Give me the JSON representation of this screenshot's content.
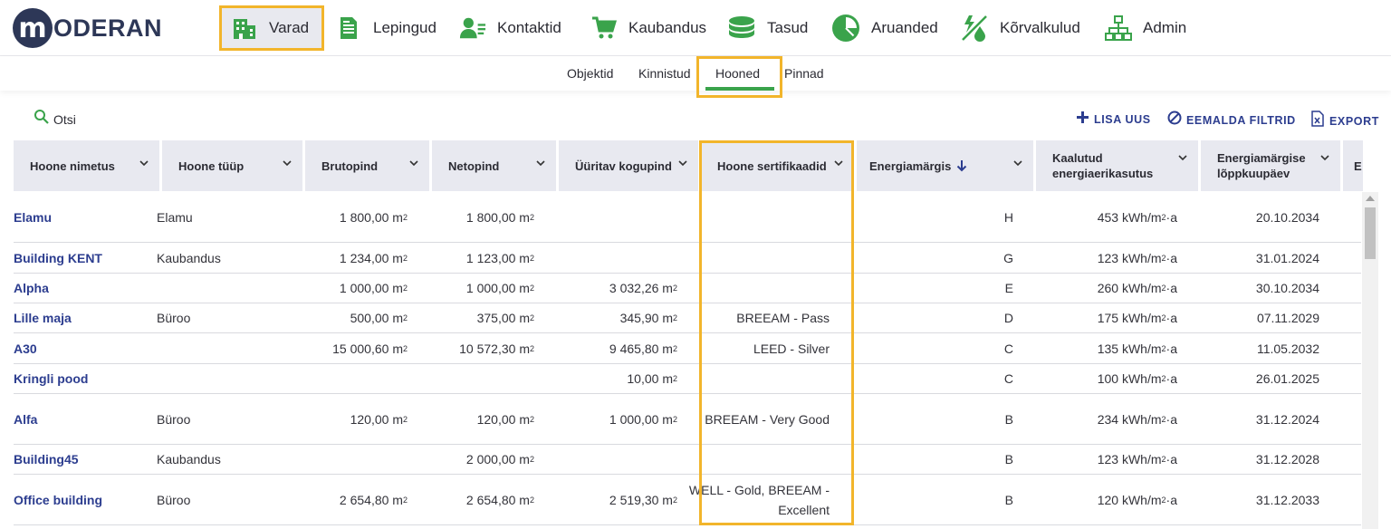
{
  "logo": {
    "letter": "m",
    "text": "ODERAN"
  },
  "nav": [
    {
      "label": "Varad",
      "icon": "buildings-icon",
      "active": true
    },
    {
      "label": "Lepingud",
      "icon": "document-icon"
    },
    {
      "label": "Kontaktid",
      "icon": "contacts-icon"
    },
    {
      "label": "Kaubandus",
      "icon": "cart-icon"
    },
    {
      "label": "Tasud",
      "icon": "coins-icon"
    },
    {
      "label": "Aruanded",
      "icon": "pie-chart-icon"
    },
    {
      "label": "Kõrvalkulud",
      "icon": "utilities-icon"
    },
    {
      "label": "Admin",
      "icon": "org-chart-icon"
    }
  ],
  "subnav": [
    {
      "label": "Objektid"
    },
    {
      "label": "Kinnistud"
    },
    {
      "label": "Hooned",
      "active": true
    },
    {
      "label": "Pinnad"
    }
  ],
  "toolbar": {
    "search_label": "Otsi",
    "add_label": "LISA UUS",
    "clear_filters_label": "EEMALDA FILTRID",
    "export_label": "EXPORT"
  },
  "columns": [
    {
      "label": "Hoone nimetus"
    },
    {
      "label": "Hoone tüüp"
    },
    {
      "label": "Brutopind"
    },
    {
      "label": "Netopind"
    },
    {
      "label": "Üüritav kogupind"
    },
    {
      "label": "Hoone sertifikaadid"
    },
    {
      "label": "Energiamärgis",
      "sorted": "desc"
    },
    {
      "label": "Kaalutud energiaerikasutus"
    },
    {
      "label": "Energiamärgise lõppkuupäev"
    },
    {
      "label": "E"
    }
  ],
  "rows": [
    {
      "name": "Elamu",
      "type": "Elamu",
      "gross": "1 800,00 m²",
      "net": "1 800,00 m²",
      "rentable": "",
      "cert": "",
      "label": "H",
      "energy": "453 kWh/m² ·a",
      "expiry": "20.10.2034"
    },
    {
      "name": "Building KENT",
      "type": "Kaubandus",
      "gross": "1 234,00 m²",
      "net": "1 123,00 m²",
      "rentable": "",
      "cert": "",
      "label": "G",
      "energy": "123 kWh/m² ·a",
      "expiry": "31.01.2024"
    },
    {
      "name": "Alpha",
      "type": "",
      "gross": "1 000,00 m²",
      "net": "1 000,00 m²",
      "rentable": "3 032,26 m²",
      "cert": "",
      "label": "E",
      "energy": "260 kWh/m² ·a",
      "expiry": "30.10.2034"
    },
    {
      "name": "Lille maja",
      "type": "Büroo",
      "gross": "500,00 m²",
      "net": "375,00 m²",
      "rentable": "345,90 m²",
      "cert": "BREEAM - Pass",
      "label": "D",
      "energy": "175 kWh/m² ·a",
      "expiry": "07.11.2029"
    },
    {
      "name": "A30",
      "type": "",
      "gross": "15 000,60 m²",
      "net": "10 572,30 m²",
      "rentable": "9 465,80 m²",
      "cert": "LEED - Silver",
      "label": "C",
      "energy": "135 kWh/m² ·a",
      "expiry": "11.05.2032"
    },
    {
      "name": "Kringli pood",
      "type": "",
      "gross": "",
      "net": "",
      "rentable": "10,00 m²",
      "cert": "",
      "label": "C",
      "energy": "100 kWh/m² ·a",
      "expiry": "26.01.2025"
    },
    {
      "name": "Alfa",
      "type": "Büroo",
      "gross": "120,00 m²",
      "net": "120,00 m²",
      "rentable": "1 000,00 m²",
      "cert": "BREEAM - Very Good",
      "label": "B",
      "energy": "234 kWh/m² ·a",
      "expiry": "31.12.2024"
    },
    {
      "name": "Building45",
      "type": "Kaubandus",
      "gross": "",
      "net": "2 000,00 m²",
      "rentable": "",
      "cert": "",
      "label": "B",
      "energy": "123 kWh/m² ·a",
      "expiry": "31.12.2028"
    },
    {
      "name": "Office building",
      "type": "Büroo",
      "gross": "2 654,80 m²",
      "net": "2 654,80 m²",
      "rentable": "2 519,30 m²",
      "cert": "WELL - Gold, BREEAM - Excellent",
      "label": "B",
      "energy": "120 kWh/m² ·a",
      "expiry": "31.12.2033"
    }
  ],
  "colors": {
    "accent_green": "#3aa34b",
    "link_blue": "#2c3d8f",
    "highlight": "#f2b52b",
    "header_bg": "#e8e9f0"
  }
}
